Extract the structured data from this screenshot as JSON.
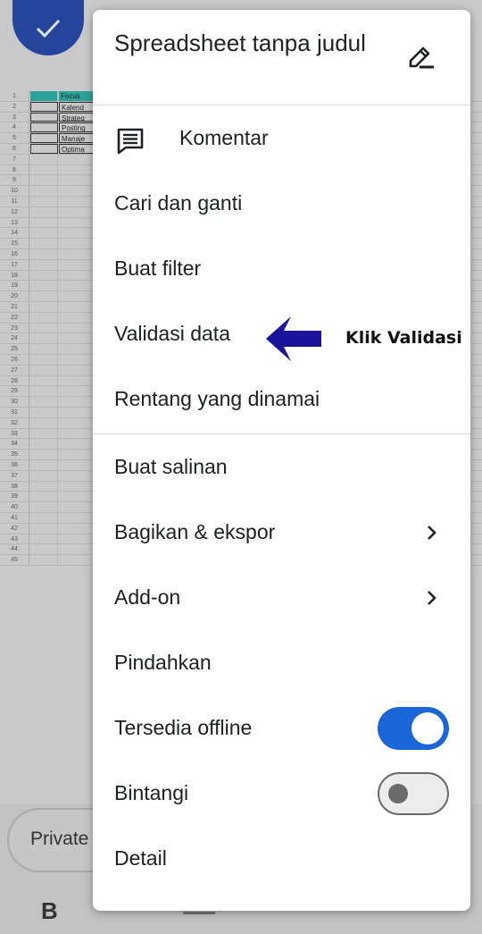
{
  "background": {
    "sheet_rows": [
      "1",
      "2",
      "3",
      "4",
      "5",
      "6",
      "7",
      "8",
      "9",
      "10",
      "11",
      "12",
      "13",
      "14",
      "15",
      "16",
      "17",
      "18",
      "19",
      "20",
      "21",
      "22",
      "23",
      "24",
      "25",
      "26",
      "27",
      "28",
      "29",
      "30",
      "31",
      "32",
      "33",
      "34",
      "35",
      "36",
      "37",
      "38",
      "39",
      "40",
      "41",
      "42",
      "43",
      "44",
      "45"
    ],
    "column_b_cells": [
      "Focus",
      "Kalend",
      "Strateg",
      "Posting",
      "Manaje",
      "Optima"
    ],
    "private_chip": "Private",
    "format_bold": "B"
  },
  "menu": {
    "title": "Spreadsheet tanpa judul",
    "items": [
      {
        "label": "Komentar"
      },
      {
        "label": "Cari dan ganti"
      },
      {
        "label": "Buat filter"
      },
      {
        "label": "Validasi data"
      },
      {
        "label": "Rentang yang dinamai"
      },
      {
        "label": "Buat salinan"
      },
      {
        "label": "Bagikan & ekspor"
      },
      {
        "label": "Add-on"
      },
      {
        "label": "Pindahkan"
      },
      {
        "label": "Tersedia offline",
        "toggle": "on"
      },
      {
        "label": "Bintangi",
        "toggle": "off"
      },
      {
        "label": "Detail"
      }
    ]
  },
  "annotation": {
    "text": "Klik Validasi",
    "arrow_color": "#1a139c"
  },
  "colors": {
    "accent": "#1a65d8",
    "fab": "#24459b",
    "header_cell": "#2aa49a"
  },
  "icons": [
    "check-icon",
    "comment-icon",
    "edit-pencil-icon",
    "chevron-right-icon",
    "arrow-left-icon"
  ]
}
